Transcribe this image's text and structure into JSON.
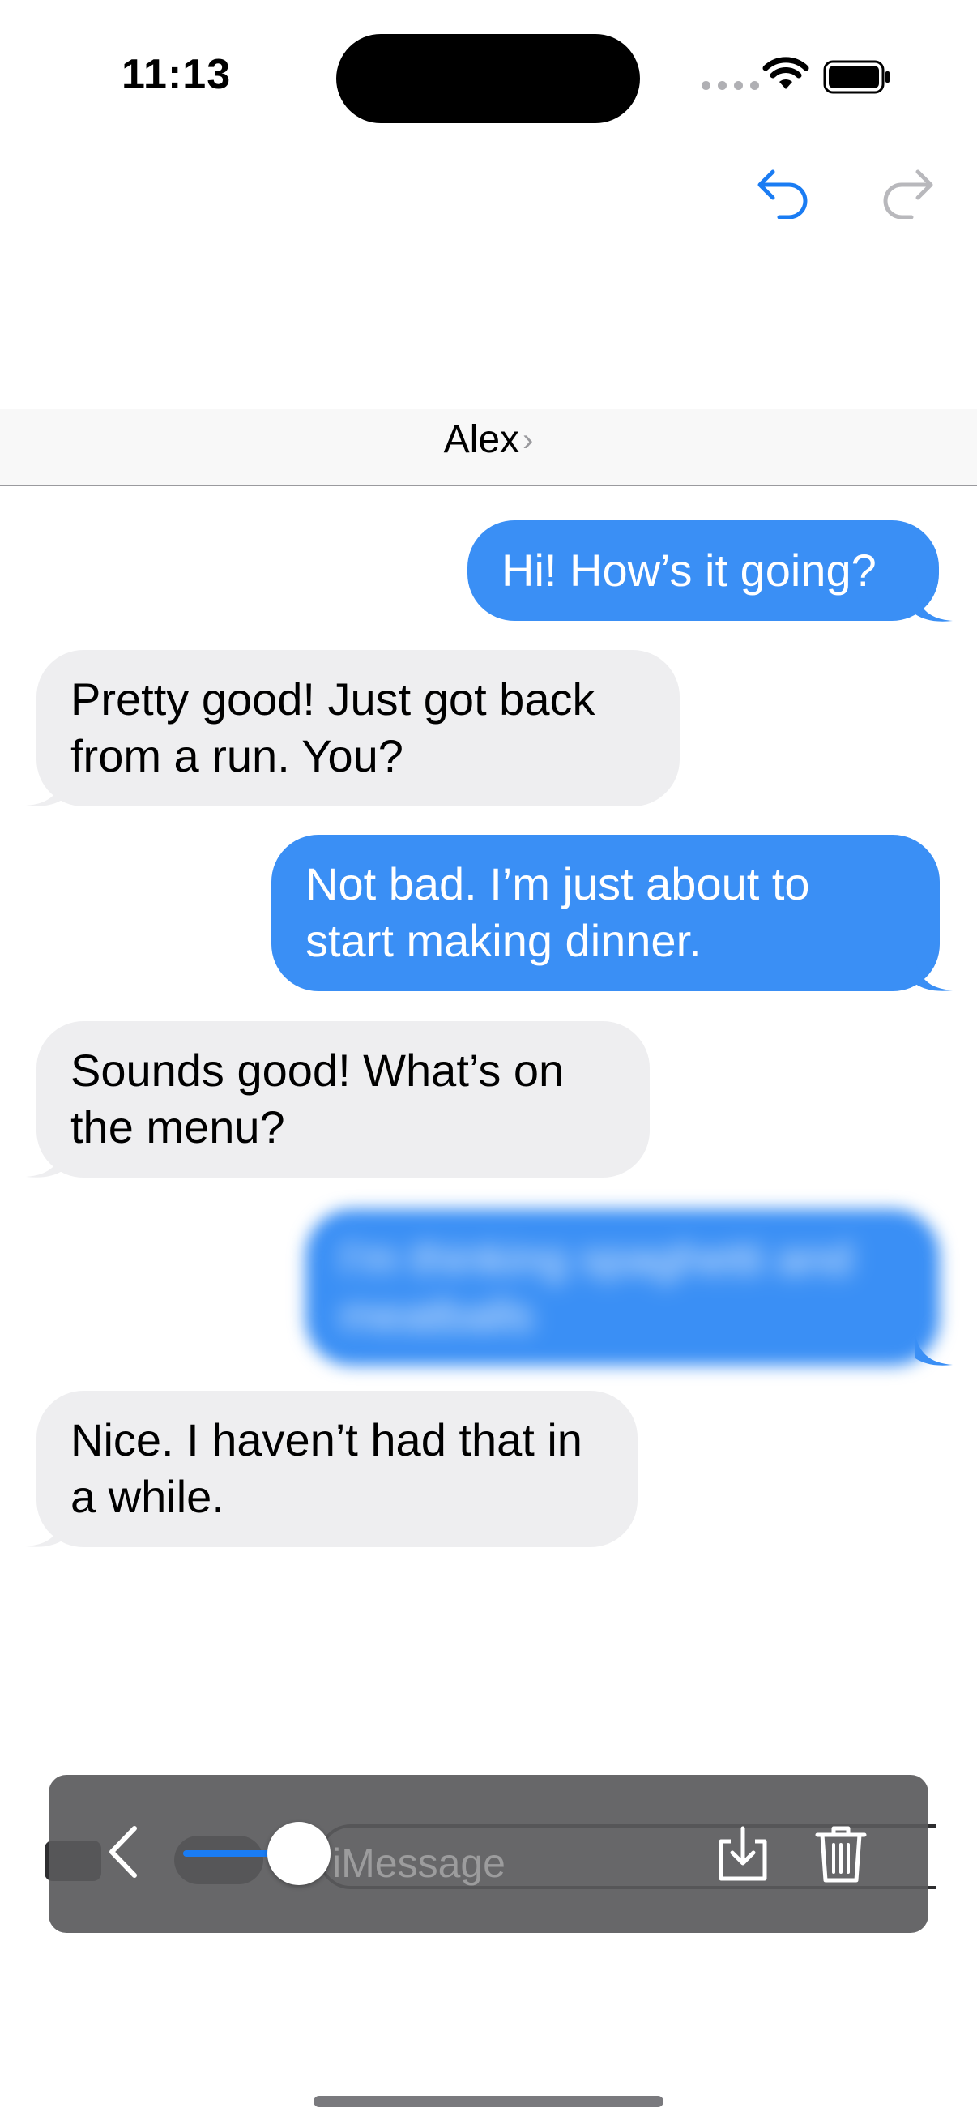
{
  "status_bar": {
    "time": "11:13"
  },
  "conversation": {
    "contact_name": "Alex",
    "messages": [
      {
        "from": "me",
        "text": "Hi! How’s it going?"
      },
      {
        "from": "them",
        "text": "Pretty good! Just got back from a run. You?"
      },
      {
        "from": "me",
        "text": "Not bad. I’m just about to start making dinner."
      },
      {
        "from": "them",
        "text": "Sounds good! What’s on the menu?"
      },
      {
        "from": "me",
        "text": "I'm thinking spaghetti and meatballs",
        "blurred": true
      },
      {
        "from": "them",
        "text": "Nice. I haven’t had that in a while."
      }
    ]
  },
  "composer": {
    "placeholder": "iMessage"
  },
  "playback": {
    "progress": 0.2
  },
  "colors": {
    "sent_bubble": "#3a8ff5",
    "received_bubble": "#eeeef0",
    "accent": "#1a7cf3"
  },
  "icons": [
    "wifi-icon",
    "battery-icon",
    "undo-icon",
    "redo-icon",
    "chevron-right-icon",
    "back-icon",
    "save-icon",
    "trash-icon"
  ]
}
